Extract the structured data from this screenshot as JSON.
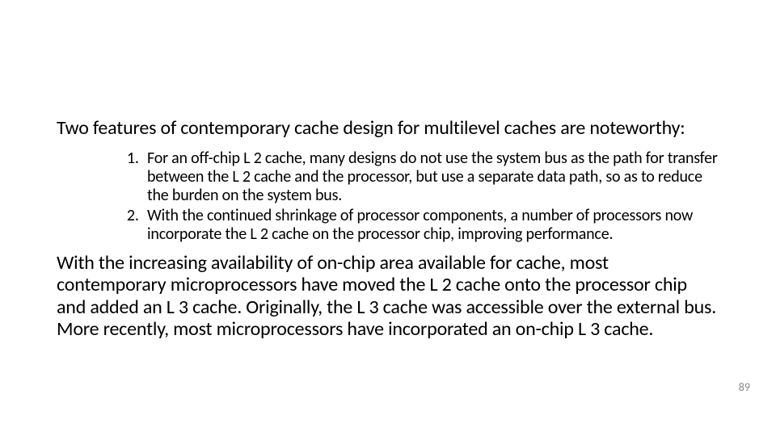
{
  "intro": "Two features of contemporary cache design for multilevel caches are noteworthy:",
  "points": [
    "For an off-chip L 2 cache, many designs do not use the system bus as the path for transfer between the L 2 cache and the processor, but use a separate data path, so as to reduce the burden on the system bus.",
    "With the continued shrinkage of processor components, a number of processors now incorporate the L 2 cache on the processor chip, improving performance."
  ],
  "closing": "With the increasing availability of on-chip area available for cache, most contemporary microprocessors have moved the L 2 cache onto the processor chip and added an L 3 cache. Originally, the L 3 cache was accessible over the external bus. More recently, most microprocessors have incorporated an on-chip L 3 cache.",
  "page_number": "89"
}
